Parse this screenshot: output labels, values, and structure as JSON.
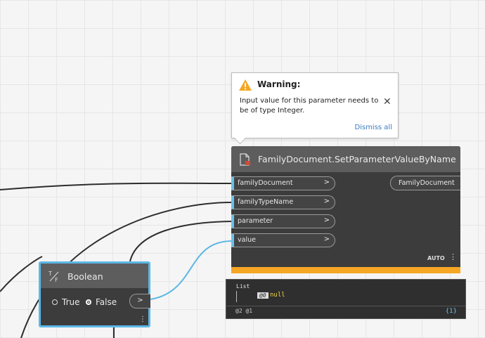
{
  "warning": {
    "title": "Warning:",
    "message": "Input value for this parameter needs to be of type Integer.",
    "dismiss_label": "Dismiss all",
    "icon": "warning-triangle-icon",
    "accent": "#f5a623"
  },
  "node": {
    "title": "FamilyDocument.SetParameterValueByName",
    "inputs": [
      "familyDocument",
      "familyTypeName",
      "parameter",
      "value"
    ],
    "output": "FamilyDocument",
    "lacing": "AUTO",
    "status_color": "#f5a623"
  },
  "preview": {
    "list_label": "List",
    "index": "@0",
    "value": "null",
    "levels": "@2 @1",
    "count": "{1}"
  },
  "boolean_node": {
    "title": "Boolean",
    "options": [
      "True",
      "False"
    ],
    "selected": "False",
    "output_symbol": ">"
  },
  "port_chevron": ">"
}
